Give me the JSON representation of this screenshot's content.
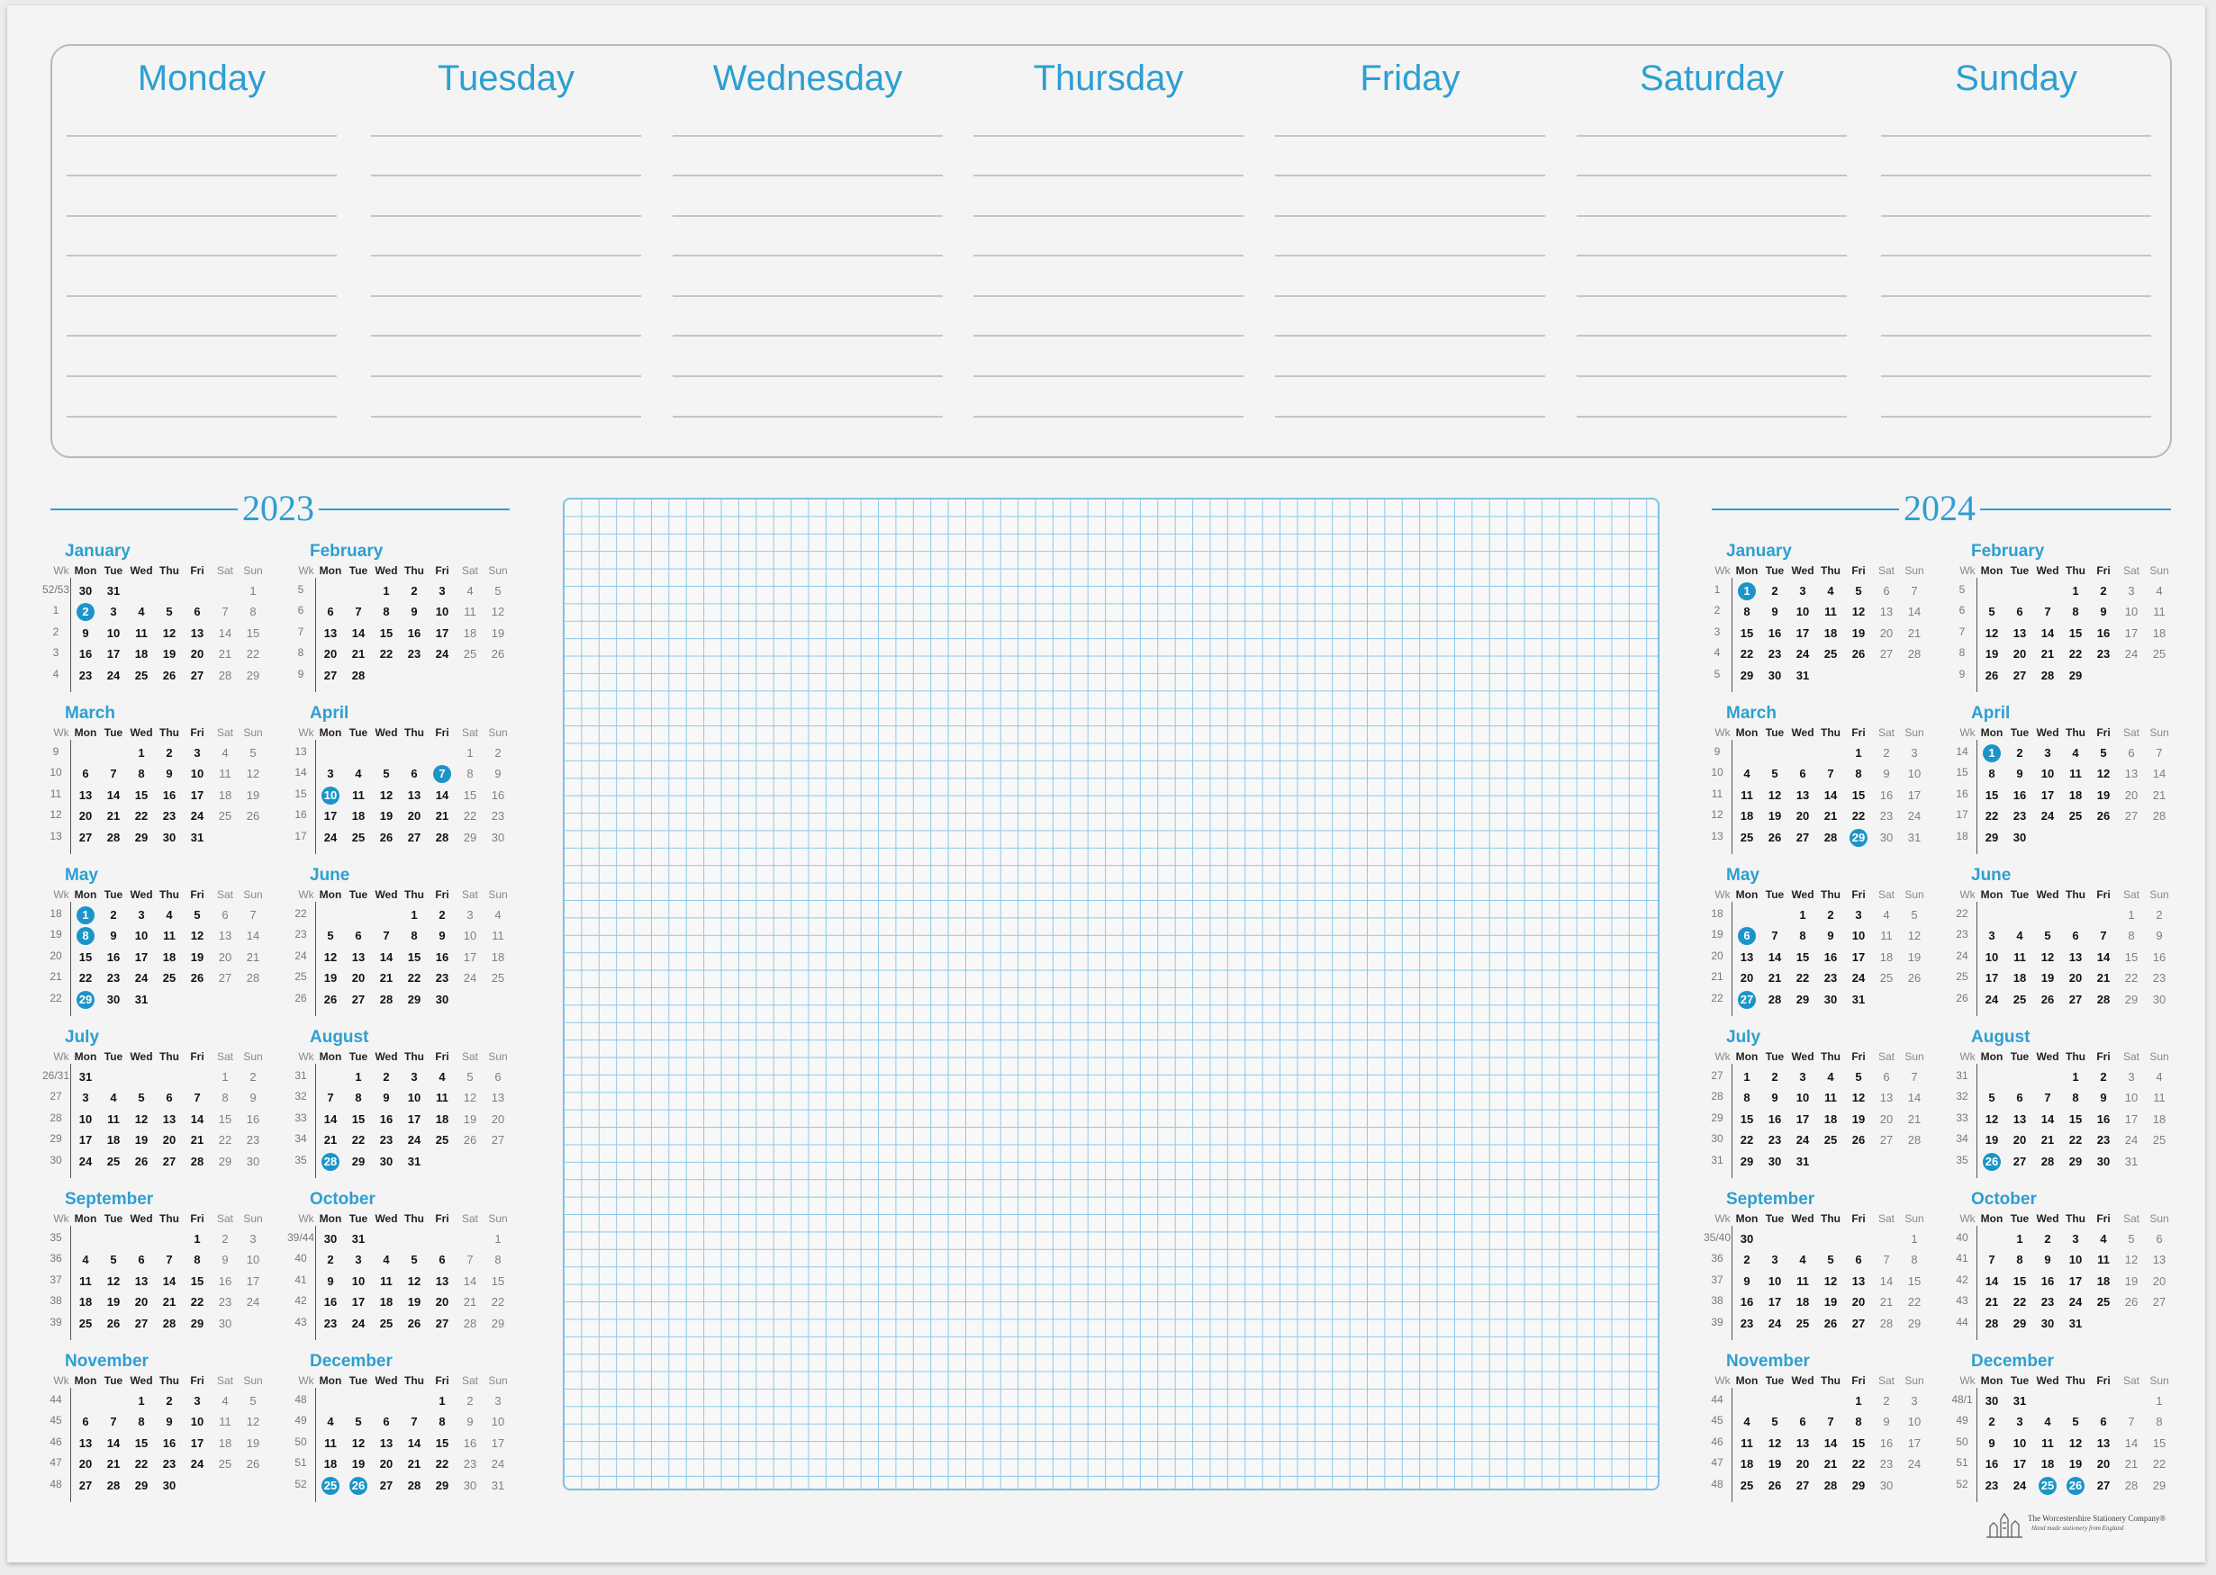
{
  "days": [
    "Monday",
    "Tuesday",
    "Wednesday",
    "Thursday",
    "Friday",
    "Saturday",
    "Sunday"
  ],
  "header_cols": [
    "Wk",
    "Mon",
    "Tue",
    "Wed",
    "Thu",
    "Fri",
    "Sat",
    "Sun"
  ],
  "years": [
    {
      "year": "2023",
      "months": [
        {
          "name": "January",
          "weeks": [
            "52/53",
            "1",
            "2",
            "3",
            "4"
          ],
          "offset": 6,
          "days": 31,
          "holidays": [
            2
          ]
        },
        {
          "name": "February",
          "weeks": [
            "5",
            "6",
            "7",
            "8",
            "9"
          ],
          "offset": 2,
          "days": 28,
          "holidays": []
        },
        {
          "name": "March",
          "weeks": [
            "9",
            "10",
            "11",
            "12",
            "13"
          ],
          "offset": 2,
          "days": 31,
          "holidays": []
        },
        {
          "name": "April",
          "weeks": [
            "13",
            "14",
            "15",
            "16",
            "17"
          ],
          "offset": 5,
          "days": 30,
          "holidays": [
            7,
            10
          ]
        },
        {
          "name": "May",
          "weeks": [
            "18",
            "19",
            "20",
            "21",
            "22"
          ],
          "offset": 0,
          "days": 31,
          "holidays": [
            1,
            8,
            29
          ]
        },
        {
          "name": "June",
          "weeks": [
            "22",
            "23",
            "24",
            "25",
            "26"
          ],
          "offset": 3,
          "days": 30,
          "holidays": []
        },
        {
          "name": "July",
          "weeks": [
            "26/31",
            "27",
            "28",
            "29",
            "30"
          ],
          "offset": 5,
          "days": 31,
          "holidays": []
        },
        {
          "name": "August",
          "weeks": [
            "31",
            "32",
            "33",
            "34",
            "35"
          ],
          "offset": 1,
          "days": 31,
          "holidays": [
            28
          ]
        },
        {
          "name": "September",
          "weeks": [
            "35",
            "36",
            "37",
            "38",
            "39"
          ],
          "offset": 4,
          "days": 30,
          "holidays": []
        },
        {
          "name": "October",
          "weeks": [
            "39/44",
            "40",
            "41",
            "42",
            "43"
          ],
          "offset": 6,
          "days": 31,
          "holidays": []
        },
        {
          "name": "November",
          "weeks": [
            "44",
            "45",
            "46",
            "47",
            "48"
          ],
          "offset": 2,
          "days": 30,
          "holidays": []
        },
        {
          "name": "December",
          "weeks": [
            "48",
            "49",
            "50",
            "51",
            "52"
          ],
          "offset": 4,
          "days": 31,
          "holidays": [
            25,
            26
          ]
        }
      ]
    },
    {
      "year": "2024",
      "months": [
        {
          "name": "January",
          "weeks": [
            "1",
            "2",
            "3",
            "4",
            "5"
          ],
          "offset": 0,
          "days": 31,
          "holidays": [
            1
          ]
        },
        {
          "name": "February",
          "weeks": [
            "5",
            "6",
            "7",
            "8",
            "9"
          ],
          "offset": 3,
          "days": 29,
          "holidays": []
        },
        {
          "name": "March",
          "weeks": [
            "9",
            "10",
            "11",
            "12",
            "13"
          ],
          "offset": 4,
          "days": 31,
          "holidays": [
            29
          ]
        },
        {
          "name": "April",
          "weeks": [
            "14",
            "15",
            "16",
            "17",
            "18"
          ],
          "offset": 0,
          "days": 30,
          "holidays": [
            1
          ]
        },
        {
          "name": "May",
          "weeks": [
            "18",
            "19",
            "20",
            "21",
            "22"
          ],
          "offset": 2,
          "days": 31,
          "holidays": [
            6,
            27
          ]
        },
        {
          "name": "June",
          "weeks": [
            "22",
            "23",
            "24",
            "25",
            "26"
          ],
          "offset": 5,
          "days": 30,
          "holidays": []
        },
        {
          "name": "July",
          "weeks": [
            "27",
            "28",
            "29",
            "30",
            "31"
          ],
          "offset": 0,
          "days": 31,
          "holidays": []
        },
        {
          "name": "August",
          "weeks": [
            "31",
            "32",
            "33",
            "34",
            "35"
          ],
          "offset": 3,
          "days": 31,
          "holidays": [
            26
          ]
        },
        {
          "name": "September",
          "weeks": [
            "35/40",
            "36",
            "37",
            "38",
            "39"
          ],
          "offset": 6,
          "days": 30,
          "holidays": []
        },
        {
          "name": "October",
          "weeks": [
            "40",
            "41",
            "42",
            "43",
            "44"
          ],
          "offset": 1,
          "days": 31,
          "holidays": []
        },
        {
          "name": "November",
          "weeks": [
            "44",
            "45",
            "46",
            "47",
            "48"
          ],
          "offset": 4,
          "days": 30,
          "holidays": []
        },
        {
          "name": "December",
          "weeks": [
            "48/1",
            "49",
            "50",
            "51",
            "52"
          ],
          "offset": 6,
          "days": 31,
          "holidays": [
            25,
            26
          ]
        }
      ]
    }
  ],
  "logo": {
    "company": "The Worcestershire Stationery Company®",
    "tagline": "Hand made stationery from England"
  },
  "colors": {
    "accent": "#2d9fd1",
    "holiday_circle": "#1b95c9",
    "grid_line": "#8cc8e8",
    "weekend_text": "#7f7f7f"
  }
}
